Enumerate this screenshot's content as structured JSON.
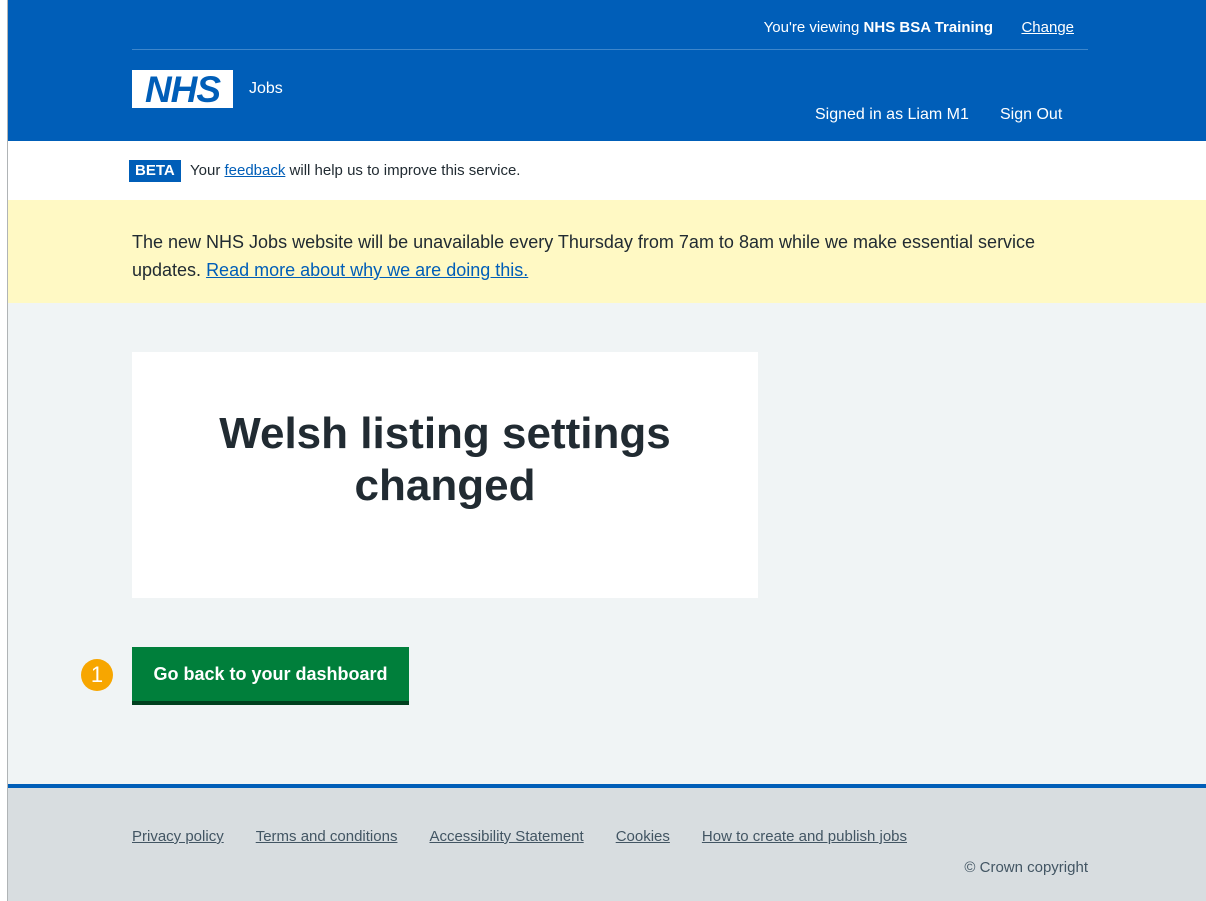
{
  "header": {
    "viewing_prefix": "You're viewing ",
    "organisation": "NHS BSA Training",
    "change_label": "Change",
    "logo_text": "NHS",
    "service_name": "Jobs",
    "signed_in_text": "Signed in as Liam M1",
    "sign_out_label": "Sign Out"
  },
  "beta": {
    "tag": "BETA",
    "text_before": "Your ",
    "feedback_link": "feedback",
    "text_after": " will help us to improve this service."
  },
  "notice": {
    "text": "The new NHS Jobs website will be unavailable every Thursday from 7am to 8am while we make essential service updates. ",
    "link": "Read more about why we are doing this."
  },
  "main": {
    "panel_title": "Welsh listing settings changed",
    "button_label": "Go back to your dashboard",
    "step_number": "1"
  },
  "footer": {
    "links": [
      "Privacy policy",
      "Terms and conditions",
      "Accessibility Statement",
      "Cookies",
      "How to create and publish jobs"
    ],
    "copyright": "© Crown copyright"
  },
  "colors": {
    "nhs_blue": "#005eb8",
    "button_green": "#007f3b",
    "notice_yellow": "#fff9c4",
    "step_badge": "#f7a600"
  }
}
